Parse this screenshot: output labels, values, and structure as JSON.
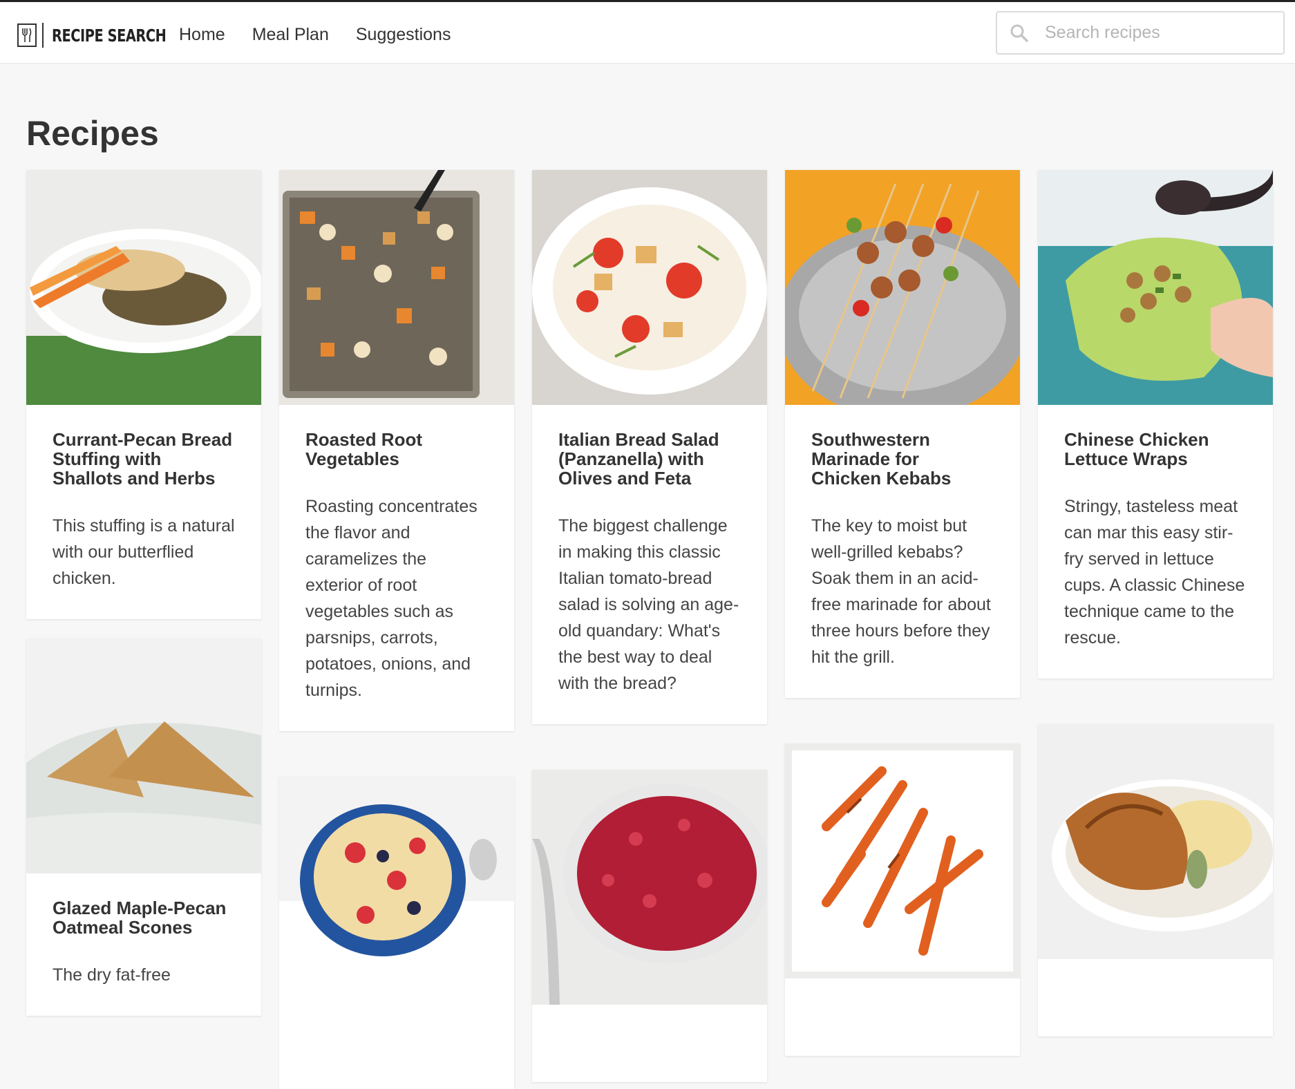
{
  "brand": {
    "name": "RECIPE SEARCH"
  },
  "nav": {
    "items": [
      {
        "label": "Home"
      },
      {
        "label": "Meal Plan"
      },
      {
        "label": "Suggestions"
      }
    ]
  },
  "search": {
    "placeholder": "Search recipes"
  },
  "page": {
    "title": "Recipes"
  },
  "recipes": [
    {
      "title": "Currant-Pecan Bread Stuffing with Shallots and Herbs",
      "description": "This stuffing is a natural with our butterflied chicken."
    },
    {
      "title": "Roasted Root Vegetables",
      "description": "Roasting concentrates the flavor and caramelizes the exterior of root vegetables such as parsnips, carrots, potatoes, onions, and turnips."
    },
    {
      "title": "Italian Bread Salad (Panzanella) with Olives and Feta",
      "description": "The biggest challenge in making this classic Italian tomato-bread salad is solving an age-old quandary: What's the best way to deal with the bread?"
    },
    {
      "title": "Southwestern Marinade for Chicken Kebabs",
      "description": "The key to moist but well-grilled kebabs? Soak them in an acid-free marinade for about three hours before they hit the grill."
    },
    {
      "title": "Chinese Chicken Lettuce Wraps",
      "description": "Stringy, tasteless meat can mar this easy stir-fry served in lettuce cups. A classic Chinese technique came to the rescue."
    },
    {
      "title": "Glazed Maple-Pecan Oatmeal Scones",
      "description": "The dry fat-free"
    },
    {
      "title": "",
      "description": ""
    },
    {
      "title": "",
      "description": ""
    },
    {
      "title": "",
      "description": ""
    },
    {
      "title": "",
      "description": ""
    }
  ],
  "colors": {
    "background": "#f7f7f7",
    "card": "#ffffff",
    "text": "#333333",
    "placeholder": "#b5b5b5"
  }
}
